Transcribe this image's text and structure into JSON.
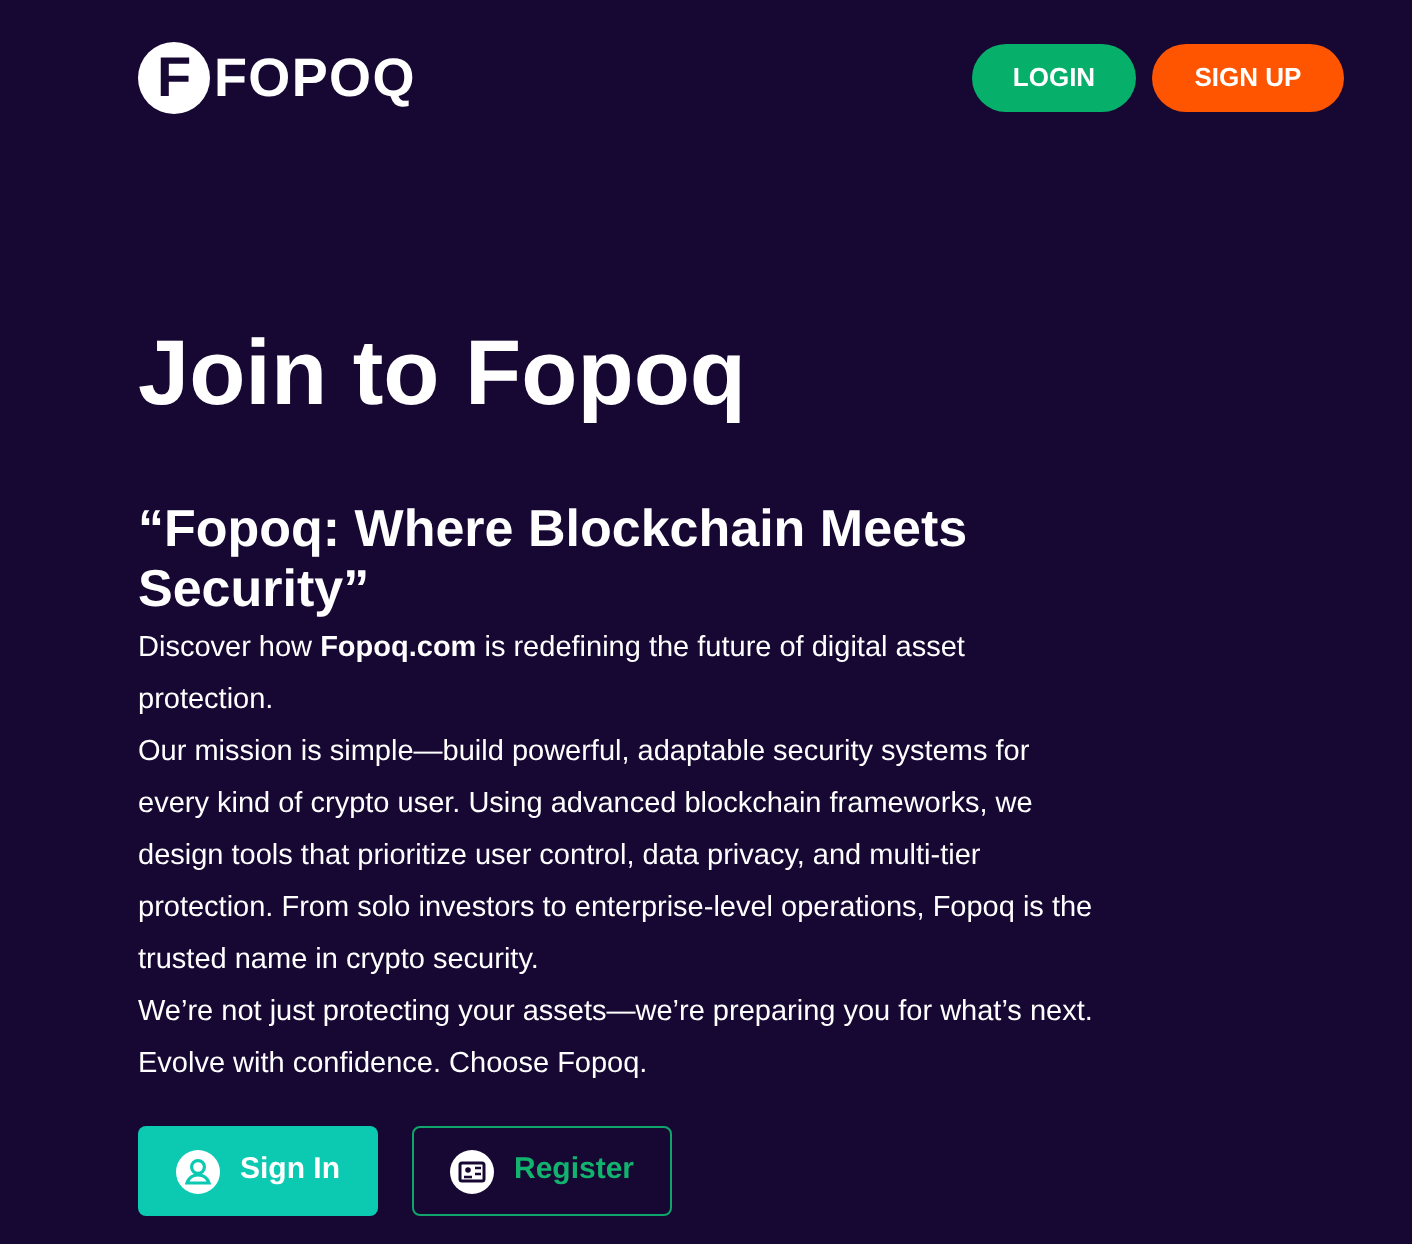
{
  "header": {
    "logo_letter": "F",
    "logo_text": "FOPOQ",
    "buttons": [
      {
        "label": "LOGIN",
        "kind": "login"
      },
      {
        "label": "SIGN UP",
        "kind": "signup"
      }
    ]
  },
  "hero": {
    "title": "Join to Fopoq",
    "subtitle": "“Fopoq: Where Blockchain Meets Security”",
    "paragraphs": [
      "Discover how **Fopoq.com** is redefining the future of digital asset protection.",
      "Our mission is simple—build powerful, adaptable security systems for every kind of crypto user. Using advanced blockchain frameworks, we design tools that prioritize user control, data privacy, and multi-tier protection. From solo investors to enterprise-level operations, Fopoq is the trusted name in crypto security.",
      "We’re not just protecting your assets—we’re preparing you for what’s next. Evolve with confidence. Choose Fopoq."
    ],
    "actions": [
      {
        "label": "Sign In",
        "kind": "filled"
      },
      {
        "label": "Register",
        "kind": "outline"
      }
    ]
  }
}
